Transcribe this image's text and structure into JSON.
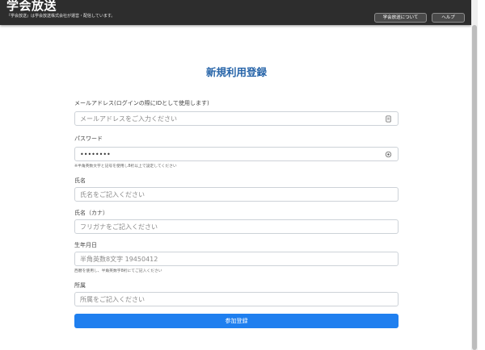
{
  "header": {
    "logo": "学会放送",
    "tagline": "『学会放送』は学会放送株式会社が運営・配信しています。",
    "nav": [
      {
        "label": "学会放送について"
      },
      {
        "label": "ヘルプ"
      }
    ]
  },
  "form": {
    "title": "新規利用登録",
    "email": {
      "label": "メールアドレス(ログインの際にIDとして使用します)",
      "placeholder": "メールアドレスをご入力ください",
      "icon": "contact-card-icon"
    },
    "password": {
      "label": "パスワード",
      "value": "••••••••",
      "hint": "※半角英数文字と記号を使用し8桁以上で設定してください",
      "icon": "eye-icon"
    },
    "name": {
      "label": "氏名",
      "placeholder": "氏名をご記入ください"
    },
    "kana": {
      "label": "氏名（カナ）",
      "placeholder": "フリガナをご記入ください"
    },
    "birthdate": {
      "label": "生年月日",
      "placeholder": "半角英数8文字 19450412",
      "hint": "西暦を使用し、半角英数字8桁にてご記入ください"
    },
    "affiliation": {
      "label": "所属",
      "placeholder": "所属をご記入ください"
    },
    "submit_label": "参加登録"
  },
  "colors": {
    "header_bg": "#2d2d2d",
    "title": "#2563a8",
    "primary_button": "#1f7fef",
    "input_border": "#cdd2d8"
  }
}
